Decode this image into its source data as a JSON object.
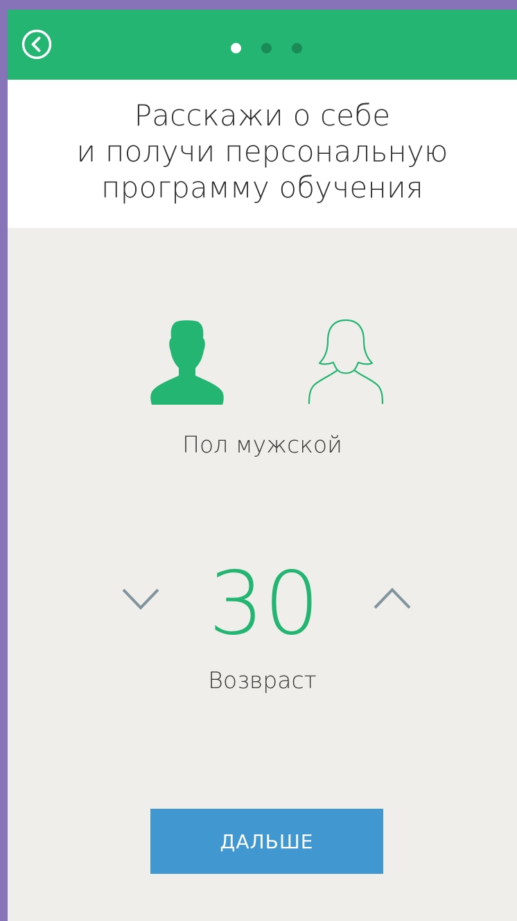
{
  "colors": {
    "accent": "#23b571",
    "button": "#4198d0",
    "background": "#efeeea",
    "chevron": "#7f949c"
  },
  "topbar": {
    "back_icon": "back-circle-icon",
    "steps_total": 3,
    "step_active": 1
  },
  "header": {
    "line1": "Расскажи о себе",
    "line2": "и получи персональную",
    "line3": "программу обучения"
  },
  "gender": {
    "male_icon": "male-avatar-icon",
    "female_icon": "female-avatar-icon",
    "selected": "male",
    "label": "Пол мужской"
  },
  "age": {
    "value": "30",
    "label": "Возвраст",
    "decrease_icon": "chevron-down-icon",
    "increase_icon": "chevron-up-icon"
  },
  "actions": {
    "next_label": "ДАЛЬШЕ"
  }
}
